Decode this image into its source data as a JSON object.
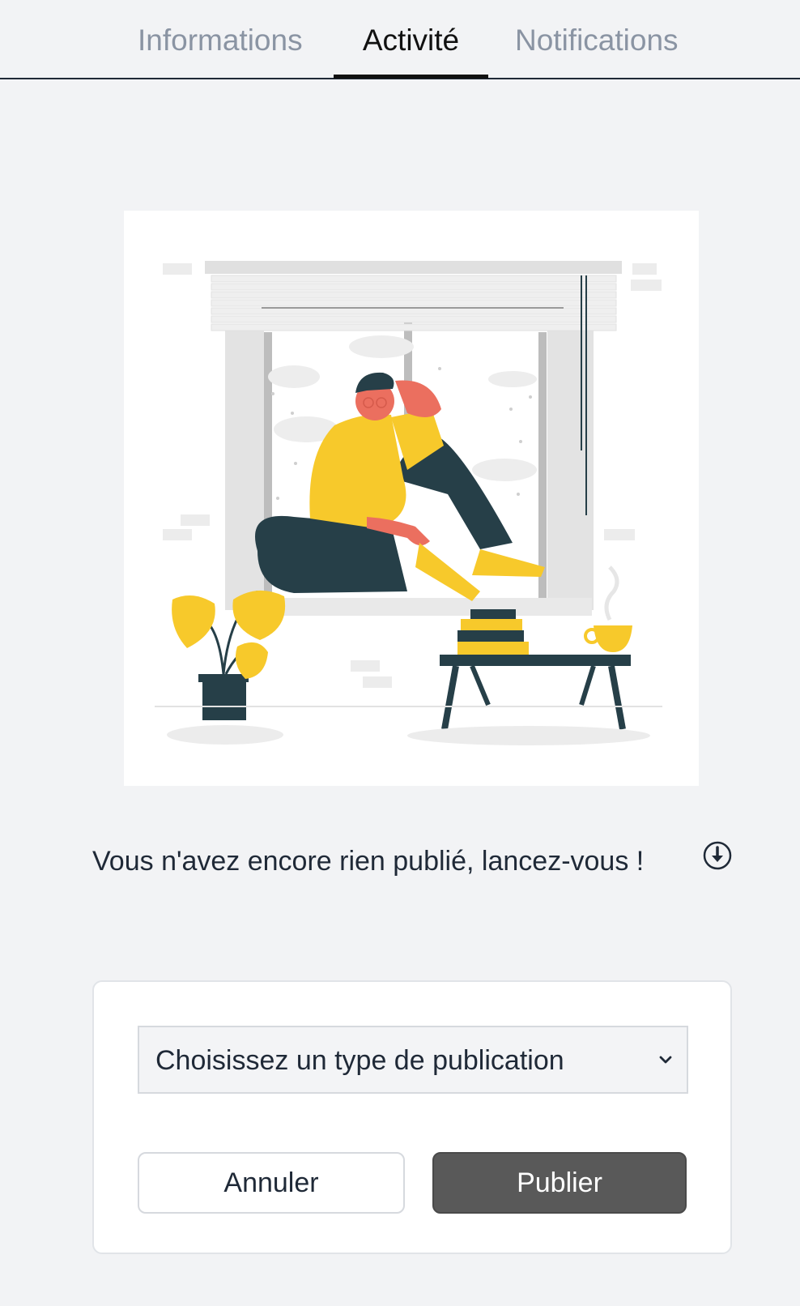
{
  "tabs": [
    {
      "label": "Informations",
      "active": false
    },
    {
      "label": "Activité",
      "active": true
    },
    {
      "label": "Notifications",
      "active": false
    }
  ],
  "empty_state": {
    "message": "Vous n'avez encore rien publié, lancez-vous !",
    "icon": "arrow-down-circle-icon",
    "illustration": "person-sitting-by-window-illustration"
  },
  "publish_form": {
    "select_value": "Choisissez un type de publication",
    "cancel_label": "Annuler",
    "publish_label": "Publier"
  },
  "colors": {
    "background": "#f2f3f5",
    "accent_yellow": "#f7c92b",
    "dark_teal": "#263f48",
    "skin": "#eb6f5f",
    "publish_button": "#595959"
  }
}
